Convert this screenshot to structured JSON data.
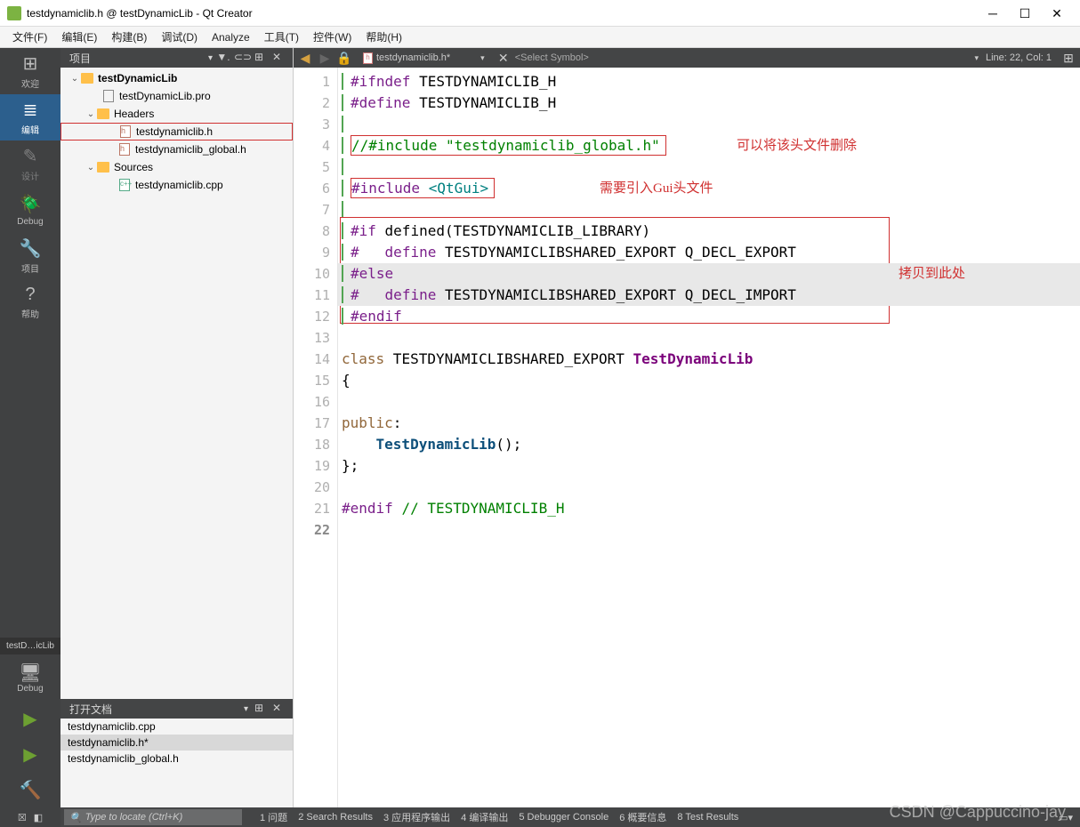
{
  "window": {
    "title": "testdynamiclib.h @ testDynamicLib - Qt Creator"
  },
  "menu": {
    "items": [
      "文件(F)",
      "编辑(E)",
      "构建(B)",
      "调试(D)",
      "Analyze",
      "工具(T)",
      "控件(W)",
      "帮助(H)"
    ]
  },
  "sidebar": {
    "modes": [
      {
        "label": "欢迎",
        "glyph": "⊞"
      },
      {
        "label": "编辑",
        "glyph": "≣"
      },
      {
        "label": "设计",
        "glyph": "✎"
      },
      {
        "label": "Debug",
        "glyph": "🪲"
      },
      {
        "label": "项目",
        "glyph": "🔧"
      },
      {
        "label": "帮助",
        "glyph": "?"
      }
    ],
    "session": "testD…icLib",
    "target": "Debug"
  },
  "project_panel": {
    "title": "项目",
    "root": "testDynamicLib",
    "pro_file": "testDynamicLib.pro",
    "headers_label": "Headers",
    "headers": [
      "testdynamiclib.h",
      "testdynamiclib_global.h"
    ],
    "sources_label": "Sources",
    "sources": [
      "testdynamiclib.cpp"
    ]
  },
  "open_docs": {
    "title": "打开文档",
    "items": [
      "testdynamiclib.cpp",
      "testdynamiclib.h*",
      "testdynamiclib_global.h"
    ],
    "active_index": 1
  },
  "editor": {
    "tab_label": "testdynamiclib.h*",
    "symbol_placeholder": "<Select Symbol>",
    "cursor": "Line: 22, Col: 1",
    "lines": [
      {
        "n": 1,
        "raw": "#ifndef TESTDYNAMICLIB_H"
      },
      {
        "n": 2,
        "raw": "#define TESTDYNAMICLIB_H"
      },
      {
        "n": 3,
        "raw": ""
      },
      {
        "n": 4,
        "raw": "//#include \"testdynamiclib_global.h\""
      },
      {
        "n": 5,
        "raw": ""
      },
      {
        "n": 6,
        "raw": "#include <QtGui>"
      },
      {
        "n": 7,
        "raw": ""
      },
      {
        "n": 8,
        "raw": "#if defined(TESTDYNAMICLIB_LIBRARY)"
      },
      {
        "n": 9,
        "raw": "#   define TESTDYNAMICLIBSHARED_EXPORT Q_DECL_EXPORT"
      },
      {
        "n": 10,
        "raw": "#else"
      },
      {
        "n": 11,
        "raw": "#   define TESTDYNAMICLIBSHARED_EXPORT Q_DECL_IMPORT"
      },
      {
        "n": 12,
        "raw": "#endif"
      },
      {
        "n": 13,
        "raw": ""
      },
      {
        "n": 14,
        "raw": "class TESTDYNAMICLIBSHARED_EXPORT TestDynamicLib"
      },
      {
        "n": 15,
        "raw": "{"
      },
      {
        "n": 16,
        "raw": ""
      },
      {
        "n": 17,
        "raw": "public:"
      },
      {
        "n": 18,
        "raw": "    TestDynamicLib();"
      },
      {
        "n": 19,
        "raw": "};"
      },
      {
        "n": 20,
        "raw": ""
      },
      {
        "n": 21,
        "raw": "#endif // TESTDYNAMICLIB_H"
      },
      {
        "n": 22,
        "raw": ""
      }
    ],
    "annotations": {
      "a1": "可以将该头文件删除",
      "a2": "需要引入Gui头文件",
      "a3": "拷贝到此处"
    }
  },
  "statusbar": {
    "locator_placeholder": "Type to locate (Ctrl+K)",
    "panes": [
      "1 问题",
      "2 Search Results",
      "3 应用程序输出",
      "4 编译输出",
      "5 Debugger Console",
      "6 概要信息",
      "8 Test Results"
    ]
  },
  "watermark": "CSDN @Cappuccino-jay"
}
